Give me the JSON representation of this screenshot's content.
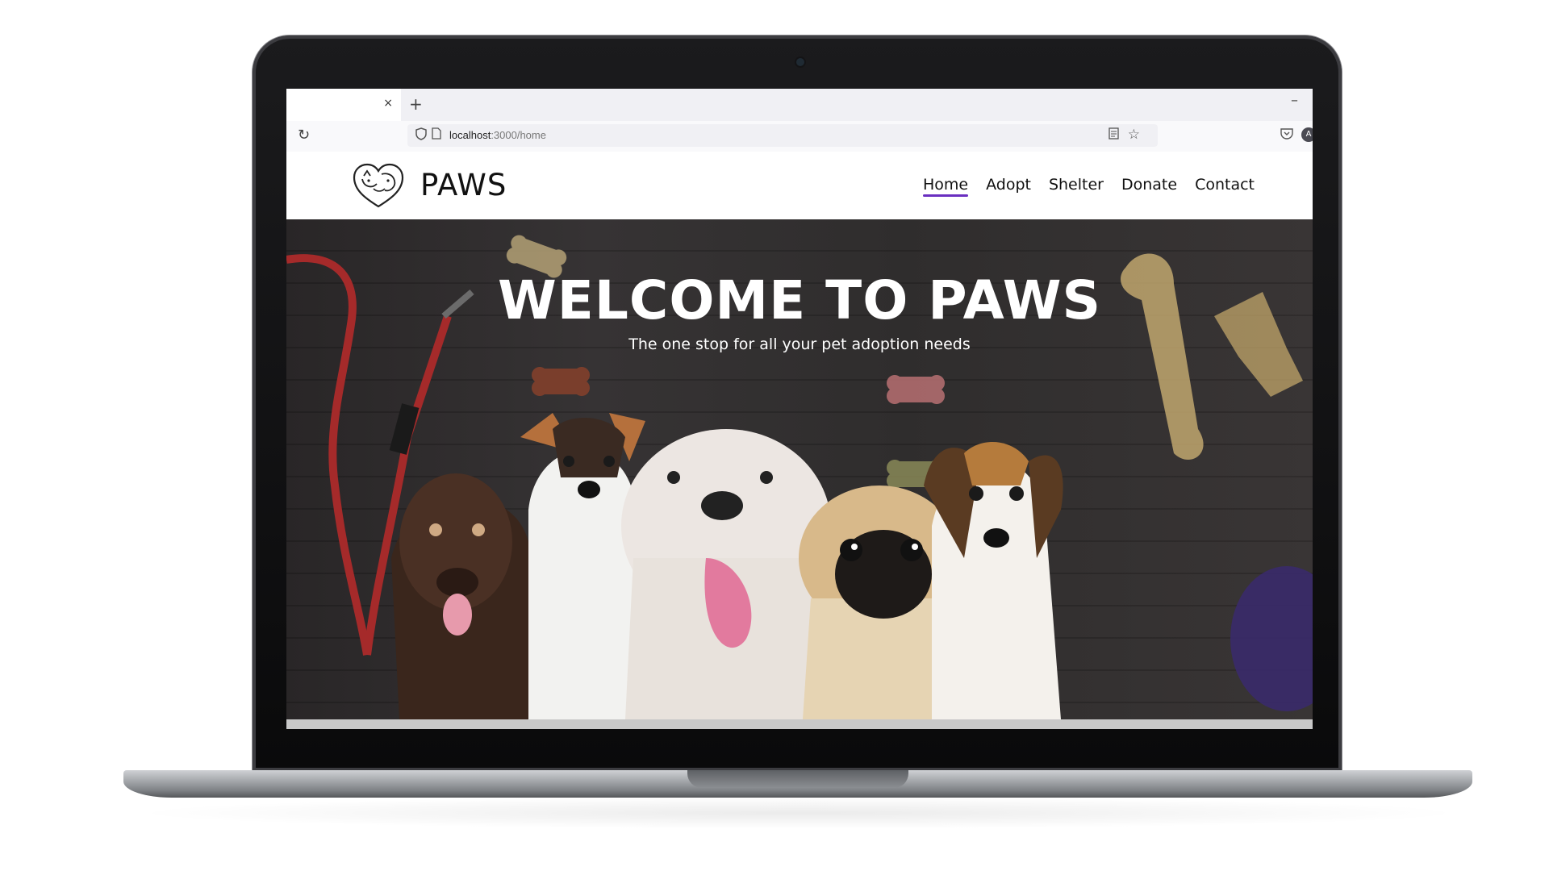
{
  "browser": {
    "tab_close": "×",
    "new_tab": "+",
    "minimize": "–",
    "reload_icon": "↻",
    "url_host": "localhost",
    "url_path": ":3000/home"
  },
  "site": {
    "brand": "PAWS",
    "nav": [
      {
        "label": "Home",
        "active": true
      },
      {
        "label": "Adopt",
        "active": false
      },
      {
        "label": "Shelter",
        "active": false
      },
      {
        "label": "Donate",
        "active": false
      },
      {
        "label": "Contact",
        "active": false
      }
    ],
    "accent_color": "#6a2fc0"
  },
  "hero": {
    "title": "WELCOME TO PAWS",
    "subtitle": "The one stop for all your pet adoption needs",
    "image": "five puppies in a row on a dark wooden floor with treats and a red leash"
  }
}
